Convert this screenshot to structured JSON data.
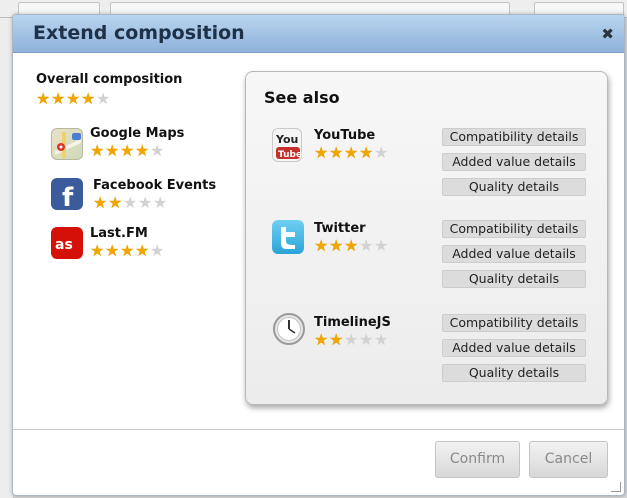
{
  "dialog": {
    "title": "Extend composition",
    "close_symbol": "✖"
  },
  "overall": {
    "label": "Overall composition",
    "rating": 4
  },
  "apps": [
    {
      "name": "Google Maps",
      "rating": 4,
      "icon": "google-maps-icon"
    },
    {
      "name": "Facebook Events",
      "rating": 2,
      "icon": "facebook-icon"
    },
    {
      "name": "Last.FM",
      "rating": 4,
      "icon": "lastfm-icon"
    }
  ],
  "see_also": {
    "title": "See also",
    "items": [
      {
        "name": "YouTube",
        "rating": 4,
        "icon": "youtube-icon"
      },
      {
        "name": "Twitter",
        "rating": 3,
        "icon": "twitter-icon"
      },
      {
        "name": "TimelineJS",
        "rating": 2,
        "icon": "clock-icon"
      }
    ],
    "buttons": {
      "compat": "Compatibility details",
      "added": "Added value details",
      "quality": "Quality details"
    }
  },
  "footer": {
    "confirm": "Confirm",
    "cancel": "Cancel"
  },
  "colors": {
    "star_on": "#f0a500",
    "star_off": "#d2d2d2",
    "titlebar": "#a8c6e8"
  }
}
